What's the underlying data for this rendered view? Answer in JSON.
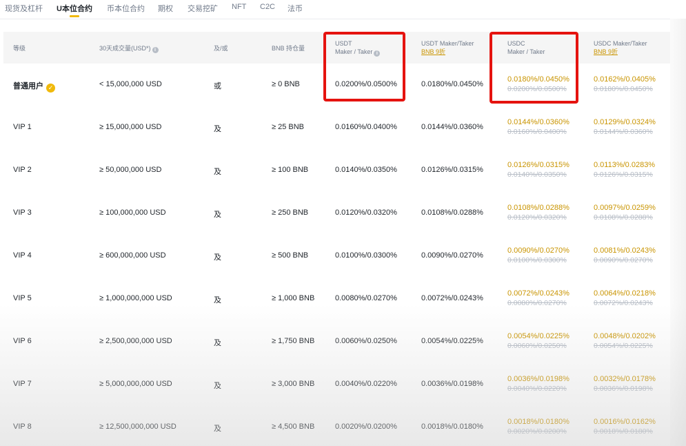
{
  "tabs": [
    {
      "label": "现货及杠杆",
      "active": false
    },
    {
      "label": "U本位合约",
      "active": true
    },
    {
      "label": "币本位合约",
      "active": false
    },
    {
      "label": "期权",
      "active": false
    },
    {
      "label": "交易挖矿",
      "active": false
    },
    {
      "label": "NFT",
      "active": false
    },
    {
      "label": "C2C",
      "active": false
    },
    {
      "label": "法币",
      "active": false
    }
  ],
  "header": {
    "level": "等级",
    "volume": "30天成交量(USD*)",
    "andor": "及/或",
    "bnb": "BNB 持仓量",
    "usdt_line1": "USDT",
    "usdt_line2": "Maker / Taker",
    "usdt_bnb_line1": "USDT Maker/Taker",
    "usdt_bnb_line2": "BNB 9折",
    "usdc_line1": "USDC",
    "usdc_line2": "Maker / Taker",
    "usdc_bnb_line1": "USDC Maker/Taker",
    "usdc_bnb_line2": "BNB 9折"
  },
  "rows": [
    {
      "level": "普通用户",
      "volume": "< 15,000,000 USD",
      "andor": "或",
      "bnb": "≥ 0 BNB",
      "usdt": "0.0200%/0.0500%",
      "usdt_bnb": "0.0180%/0.0450%",
      "usdc_new": "0.0180%/0.0450%",
      "usdc_old": "0.0200%/0.0500%",
      "usdc_bnb_new": "0.0162%/0.0405%",
      "usdc_bnb_old": "0.0180%/0.0450%"
    },
    {
      "level": "VIP 1",
      "volume": "≥ 15,000,000 USD",
      "andor": "及",
      "bnb": "≥ 25 BNB",
      "usdt": "0.0160%/0.0400%",
      "usdt_bnb": "0.0144%/0.0360%",
      "usdc_new": "0.0144%/0.0360%",
      "usdc_old": "0.0160%/0.0400%",
      "usdc_bnb_new": "0.0129%/0.0324%",
      "usdc_bnb_old": "0.0144%/0.0360%"
    },
    {
      "level": "VIP 2",
      "volume": "≥ 50,000,000 USD",
      "andor": "及",
      "bnb": "≥ 100 BNB",
      "usdt": "0.0140%/0.0350%",
      "usdt_bnb": "0.0126%/0.0315%",
      "usdc_new": "0.0126%/0.0315%",
      "usdc_old": "0.0140%/0.0350%",
      "usdc_bnb_new": "0.0113%/0.0283%",
      "usdc_bnb_old": "0.0126%/0.0315%"
    },
    {
      "level": "VIP 3",
      "volume": "≥ 100,000,000 USD",
      "andor": "及",
      "bnb": "≥ 250 BNB",
      "usdt": "0.0120%/0.0320%",
      "usdt_bnb": "0.0108%/0.0288%",
      "usdc_new": "0.0108%/0.0288%",
      "usdc_old": "0.0120%/0.0320%",
      "usdc_bnb_new": "0.0097%/0.0259%",
      "usdc_bnb_old": "0.0108%/0.0288%"
    },
    {
      "level": "VIP 4",
      "volume": "≥ 600,000,000 USD",
      "andor": "及",
      "bnb": "≥ 500 BNB",
      "usdt": "0.0100%/0.0300%",
      "usdt_bnb": "0.0090%/0.0270%",
      "usdc_new": "0.0090%/0.0270%",
      "usdc_old": "0.0100%/0.0300%",
      "usdc_bnb_new": "0.0081%/0.0243%",
      "usdc_bnb_old": "0.0090%/0.0270%"
    },
    {
      "level": "VIP 5",
      "volume": "≥ 1,000,000,000 USD",
      "andor": "及",
      "bnb": "≥ 1,000 BNB",
      "usdt": "0.0080%/0.0270%",
      "usdt_bnb": "0.0072%/0.0243%",
      "usdc_new": "0.0072%/0.0243%",
      "usdc_old": "0.0080%/0.0270%",
      "usdc_bnb_new": "0.0064%/0.0218%",
      "usdc_bnb_old": "0.0072%/0.0243%"
    },
    {
      "level": "VIP 6",
      "volume": "≥ 2,500,000,000 USD",
      "andor": "及",
      "bnb": "≥ 1,750 BNB",
      "usdt": "0.0060%/0.0250%",
      "usdt_bnb": "0.0054%/0.0225%",
      "usdc_new": "0.0054%/0.0225%",
      "usdc_old": "0.0060%/0.0250%",
      "usdc_bnb_new": "0.0048%/0.0202%",
      "usdc_bnb_old": "0.0054%/0.0225%"
    },
    {
      "level": "VIP 7",
      "volume": "≥ 5,000,000,000 USD",
      "andor": "及",
      "bnb": "≥ 3,000 BNB",
      "usdt": "0.0040%/0.0220%",
      "usdt_bnb": "0.0036%/0.0198%",
      "usdc_new": "0.0036%/0.0198%",
      "usdc_old": "0.0040%/0.0220%",
      "usdc_bnb_new": "0.0032%/0.0178%",
      "usdc_bnb_old": "0.0036%/0.0198%"
    },
    {
      "level": "VIP 8",
      "volume": "≥ 12,500,000,000 USD",
      "andor": "及",
      "bnb": "≥ 4,500 BNB",
      "usdt": "0.0020%/0.0200%",
      "usdt_bnb": "0.0018%/0.0180%",
      "usdc_new": "0.0018%/0.0180%",
      "usdc_old": "0.0020%/0.0200%",
      "usdc_bnb_new": "0.0016%/0.0162%",
      "usdc_bnb_old": "0.0018%/0.0180%"
    }
  ],
  "colors": {
    "accent": "#f0b90b",
    "discount": "#c99400",
    "strike": "#b7bdc6",
    "highlight": "#e5130f"
  }
}
